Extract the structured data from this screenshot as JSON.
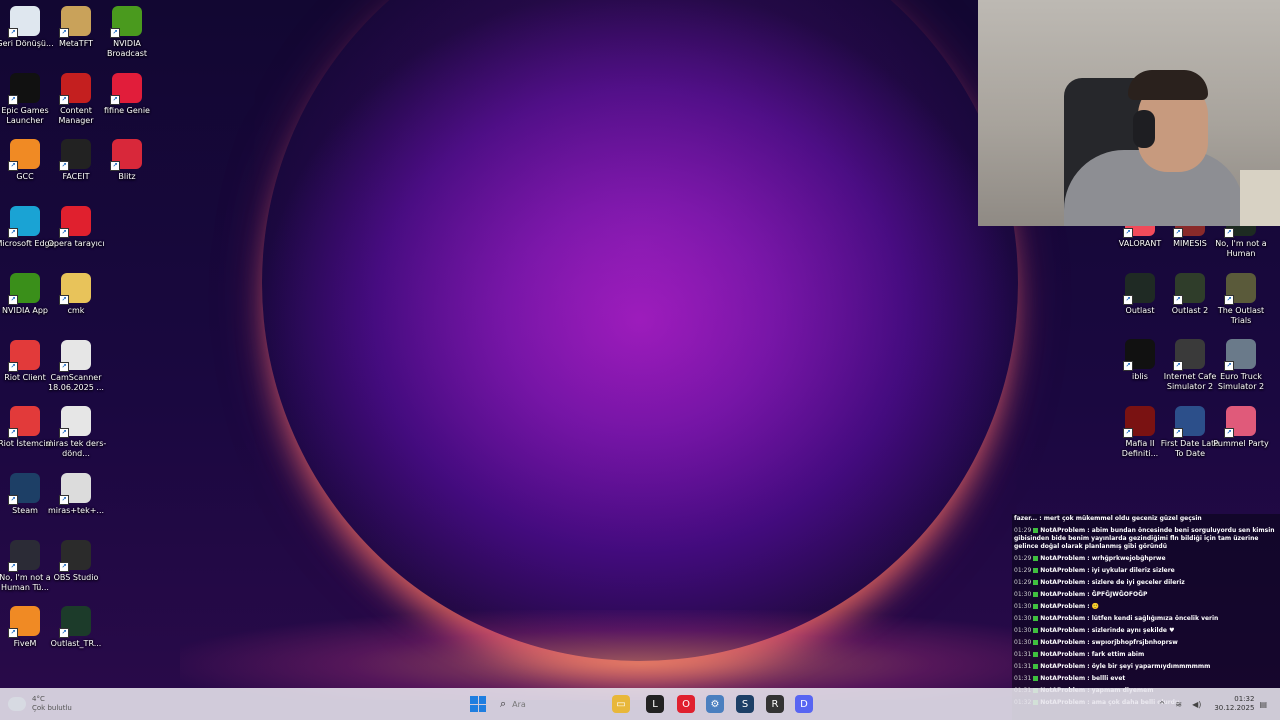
{
  "desktop_icons": {
    "col1": [
      {
        "label": "Geri Dönüşü...",
        "icon": "recycle-bin-icon",
        "color": "#dfe7ef"
      },
      {
        "label": "Epic Games Launcher",
        "icon": "epic-games-icon",
        "color": "#111111"
      },
      {
        "label": "GCC",
        "icon": "gcc-icon",
        "color": "#f08a24"
      },
      {
        "label": "Microsoft Edge",
        "icon": "edge-icon",
        "color": "#1aa3d4"
      },
      {
        "label": "NVIDIA App",
        "icon": "nvidia-icon",
        "color": "#3a8f1a"
      },
      {
        "label": "Riot Client",
        "icon": "riot-icon",
        "color": "#e23a3a"
      },
      {
        "label": "Riot İstemcisi",
        "icon": "riot-icon",
        "color": "#e23a3a"
      },
      {
        "label": "Steam",
        "icon": "steam-icon",
        "color": "#1d3f66"
      },
      {
        "label": "No, I'm not a Human Tü...",
        "icon": "game-icon",
        "color": "#2b2b36"
      },
      {
        "label": "FiveM",
        "icon": "fivem-icon",
        "color": "#f08a24"
      }
    ],
    "col2": [
      {
        "label": "MetaTFT",
        "icon": "metatft-icon",
        "color": "#c9a25a"
      },
      {
        "label": "Content Manager",
        "icon": "content-manager-icon",
        "color": "#c41f1f"
      },
      {
        "label": "FACEIT",
        "icon": "faceit-icon",
        "color": "#222222"
      },
      {
        "label": "Opera tarayıcı",
        "icon": "opera-icon",
        "color": "#e0202e"
      },
      {
        "label": "cmk",
        "icon": "folder-icon",
        "color": "#e8c35a"
      },
      {
        "label": "CamScanner 18.06.2025 ...",
        "icon": "document-icon",
        "color": "#e6e6e6"
      },
      {
        "label": "miras tek ders-dönd...",
        "icon": "document-icon",
        "color": "#e6e6e6"
      },
      {
        "label": "miras+tek+...",
        "icon": "image-icon",
        "color": "#dcdcdc"
      },
      {
        "label": "OBS Studio",
        "icon": "obs-icon",
        "color": "#2b2b2b"
      },
      {
        "label": "Outlast_TR...",
        "icon": "shield-icon",
        "color": "#1c3b2a"
      }
    ],
    "col3": [
      {
        "label": "NVIDIA Broadcast",
        "icon": "nvidia-broadcast-icon",
        "color": "#4a9a1e"
      },
      {
        "label": "fifine Genie",
        "icon": "fifine-icon",
        "color": "#e11d3a"
      },
      {
        "label": "Blitz",
        "icon": "blitz-icon",
        "color": "#d8283a"
      }
    ],
    "right_col1": [
      {
        "label": "VALORANT",
        "icon": "valorant-icon",
        "color": "#f24b5a"
      },
      {
        "label": "Outlast",
        "icon": "outlast-icon",
        "color": "#1f2a24"
      },
      {
        "label": "iblis",
        "icon": "game-icon",
        "color": "#111111"
      },
      {
        "label": "Mafia II Definiti...",
        "icon": "mafia-icon",
        "color": "#7a1212"
      }
    ],
    "right_col2": [
      {
        "label": "MIMESIS",
        "icon": "mimesis-icon",
        "color": "#8a2a2a"
      },
      {
        "label": "Outlast 2",
        "icon": "outlast2-icon",
        "color": "#2f3d2a"
      },
      {
        "label": "Internet Cafe Simulator 2",
        "icon": "ics2-icon",
        "color": "#3a3a3a"
      },
      {
        "label": "First Date Late To Date",
        "icon": "game-icon",
        "color": "#2c4f8a"
      }
    ],
    "right_col3": [
      {
        "label": "No, I'm not a Human",
        "icon": "game-icon",
        "color": "#1d2b22"
      },
      {
        "label": "The Outlast Trials",
        "icon": "outlast-trials-icon",
        "color": "#5a5a3a"
      },
      {
        "label": "Euro Truck Simulator 2",
        "icon": "ets2-icon",
        "color": "#6a7a8a"
      },
      {
        "label": "Pummel Party",
        "icon": "pummel-party-icon",
        "color": "#e05a7a"
      }
    ]
  },
  "chat": {
    "messages": [
      {
        "time": "",
        "user": "",
        "text": "fazer... : mert çok mükemmel oldu geceniz güzel geçsin"
      },
      {
        "time": "01:29",
        "user": "NotAProblem",
        "text": "abim bundan öncesinde beni sorguluyordu sen kimsin gibisinden bide benim yayınlarda gezindiğimi fln bildiği için tam üzerine gelince doğal olarak planlanmış gibi göründü"
      },
      {
        "time": "01:29",
        "user": "NotAProblem",
        "text": "wrhğprkwejobğhprwe"
      },
      {
        "time": "01:29",
        "user": "NotAProblem",
        "text": "iyi uykular dileriz sizlere"
      },
      {
        "time": "01:29",
        "user": "NotAProblem",
        "text": "sizlere de iyi geceler dileriz"
      },
      {
        "time": "01:30",
        "user": "NotAProblem",
        "text": "ĞPFĞJWĞOFOĞP"
      },
      {
        "time": "01:30",
        "user": "NotAProblem",
        "text": "🙂"
      },
      {
        "time": "01:30",
        "user": "NotAProblem",
        "text": "lütfen kendi sağlığımıza öncelik verin"
      },
      {
        "time": "01:30",
        "user": "NotAProblem",
        "text": "sizlerinde aynı şekilde ♥"
      },
      {
        "time": "01:30",
        "user": "NotAProblem",
        "text": "swpıorjbhopfrsjbnhoprsw"
      },
      {
        "time": "01:31",
        "user": "NotAProblem",
        "text": "fark ettim abim"
      },
      {
        "time": "01:31",
        "user": "NotAProblem",
        "text": "öyle bir şeyi yaparmıydımmmmmm"
      },
      {
        "time": "01:31",
        "user": "NotAProblem",
        "text": "bellli evet"
      },
      {
        "time": "01:31",
        "user": "NotAProblem",
        "text": "yapmam diyemem"
      },
      {
        "time": "01:32",
        "user": "NotAProblem",
        "text": "ama çok daha belli olurdu"
      }
    ]
  },
  "taskbar": {
    "weather_temp": "4°C",
    "weather_desc": "Çok bulutlu",
    "search_placeholder": "Ara",
    "clock_time": "01:32",
    "clock_date": "30.12.2025",
    "apps": [
      {
        "name": "taskbar-app-file-explorer",
        "icon": "folder-icon",
        "color": "#e8b73a",
        "glyph": "▭"
      },
      {
        "name": "taskbar-app-terminal",
        "icon": "terminal-icon",
        "color": "#222222",
        "glyph": "L"
      },
      {
        "name": "taskbar-app-opera",
        "icon": "opera-icon",
        "color": "#e0202e",
        "glyph": "O"
      },
      {
        "name": "taskbar-app-settings",
        "icon": "gear-icon",
        "color": "#4a7fbf",
        "glyph": "⚙"
      },
      {
        "name": "taskbar-app-steam",
        "icon": "steam-icon",
        "color": "#1d3f66",
        "glyph": "S"
      },
      {
        "name": "taskbar-app-riot",
        "icon": "riot-icon",
        "color": "#333333",
        "glyph": "R"
      },
      {
        "name": "taskbar-app-discord",
        "icon": "discord-icon",
        "color": "#5865f2",
        "glyph": "D"
      }
    ]
  }
}
